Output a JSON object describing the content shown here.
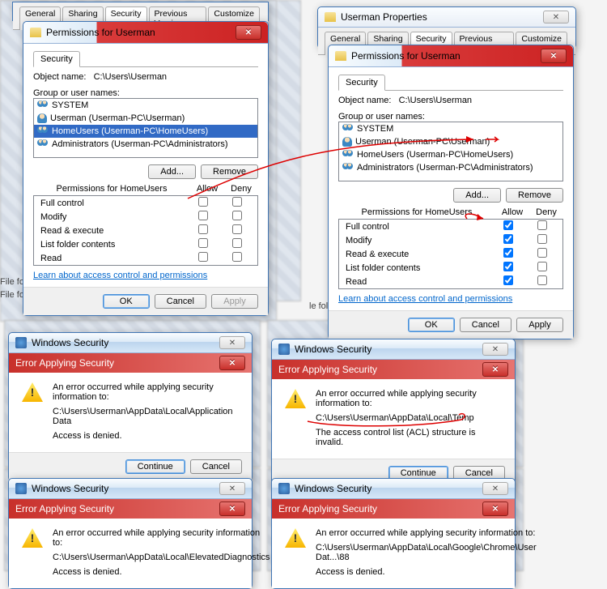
{
  "prop1": {
    "tabs": [
      "General",
      "Sharing",
      "Security",
      "Previous Versions",
      "Customize"
    ],
    "active": 2
  },
  "perm1": {
    "title": "Permissions for Userman",
    "security_tab": "Security",
    "object_label": "Object name:",
    "object_path": "C:\\Users\\Userman",
    "group_label": "Group or user names:",
    "groups": [
      "SYSTEM",
      "Userman (Userman-PC\\Userman)",
      "HomeUsers (Userman-PC\\HomeUsers)",
      "Administrators (Userman-PC\\Administrators)"
    ],
    "add": "Add...",
    "remove": "Remove",
    "perm_for": "Permissions for HomeUsers",
    "allow": "Allow",
    "deny": "Deny",
    "perms": [
      "Full control",
      "Modify",
      "Read & execute",
      "List folder contents",
      "Read"
    ],
    "allow_checked": [
      false,
      false,
      false,
      false,
      false
    ],
    "link": "Learn about access control and permissions",
    "ok": "OK",
    "cancel": "Cancel",
    "apply": "Apply"
  },
  "prop2": {
    "title": "Userman Properties",
    "tabs": [
      "General",
      "Sharing",
      "Security",
      "Previous Versions",
      "Customize"
    ]
  },
  "perm2": {
    "title": "Permissions for Userman",
    "object_path": "C:\\Users\\Userman",
    "groups": [
      "SYSTEM",
      "Userman (Userman-PC\\Userman)",
      "HomeUsers (Userman-PC\\HomeUsers)",
      "Administrators (Userman-PC\\Administrators)"
    ],
    "allow_checked": [
      true,
      true,
      true,
      true,
      true
    ],
    "ok": "OK",
    "cancel": "Cancel",
    "apply": "Apply"
  },
  "ws_title": "Windows Security",
  "err_title": "Error Applying Security",
  "err_intro": "An error occurred while applying security information to:",
  "err1": {
    "path": "C:\\Users\\Userman\\AppData\\Local\\Application Data",
    "msg": "Access is denied."
  },
  "err2": {
    "path": "C:\\Users\\Userman\\AppData\\Local\\Temp",
    "msg": "The access control list (ACL) structure is invalid."
  },
  "err3": {
    "path": "C:\\Users\\Userman\\AppData\\Local\\ElevatedDiagnostics",
    "msg": "Access is denied."
  },
  "err4": {
    "path": "C:\\Users\\Userman\\AppData\\Local\\Google\\Chrome\\User Dat...\\88",
    "msg": "Access is denied."
  },
  "cont": "Continue",
  "cancel": "Cancel",
  "file_folder": "File folder",
  "le_folder": "le folder"
}
